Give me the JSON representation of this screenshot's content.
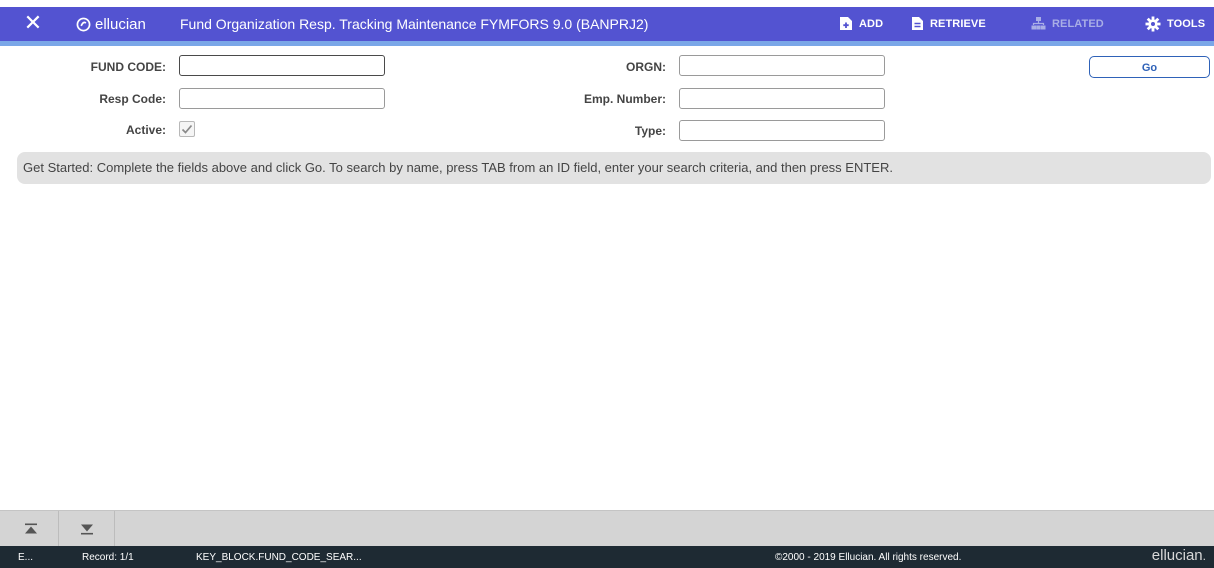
{
  "header": {
    "close_icon": "close-icon",
    "logo_text": "ellucian",
    "title": "Fund Organization Resp. Tracking Maintenance FYMFORS 9.0 (BANPRJ2)",
    "background_color": "#5353d1",
    "toolbar": {
      "add": "ADD",
      "retrieve": "RETRIEVE",
      "related": "RELATED",
      "tools": "TOOLS"
    }
  },
  "form": {
    "fund_code": {
      "label": "FUND CODE:",
      "value": ""
    },
    "resp_code": {
      "label": "Resp Code:",
      "value": ""
    },
    "active": {
      "label": "Active:",
      "checked": true
    },
    "orgn": {
      "label": "ORGN:",
      "value": ""
    },
    "emp_number": {
      "label": "Emp. Number:",
      "value": ""
    },
    "type": {
      "label": "Type:",
      "value": ""
    },
    "go_label": "Go"
  },
  "info_message": "Get Started: Complete the fields above and click Go. To search by name, press TAB from an ID field, enter your search criteria, and then press ENTER.",
  "navigation": {
    "first_icon": "first-record-icon",
    "last_icon": "last-record-icon"
  },
  "status": {
    "mode": "E...",
    "record": "Record: 1/1",
    "block_field": "KEY_BLOCK.FUND_CODE_SEAR...",
    "copyright": "©2000 - 2019 Ellucian. All rights reserved.",
    "brand": "ellucian",
    "brand_mark": "."
  }
}
